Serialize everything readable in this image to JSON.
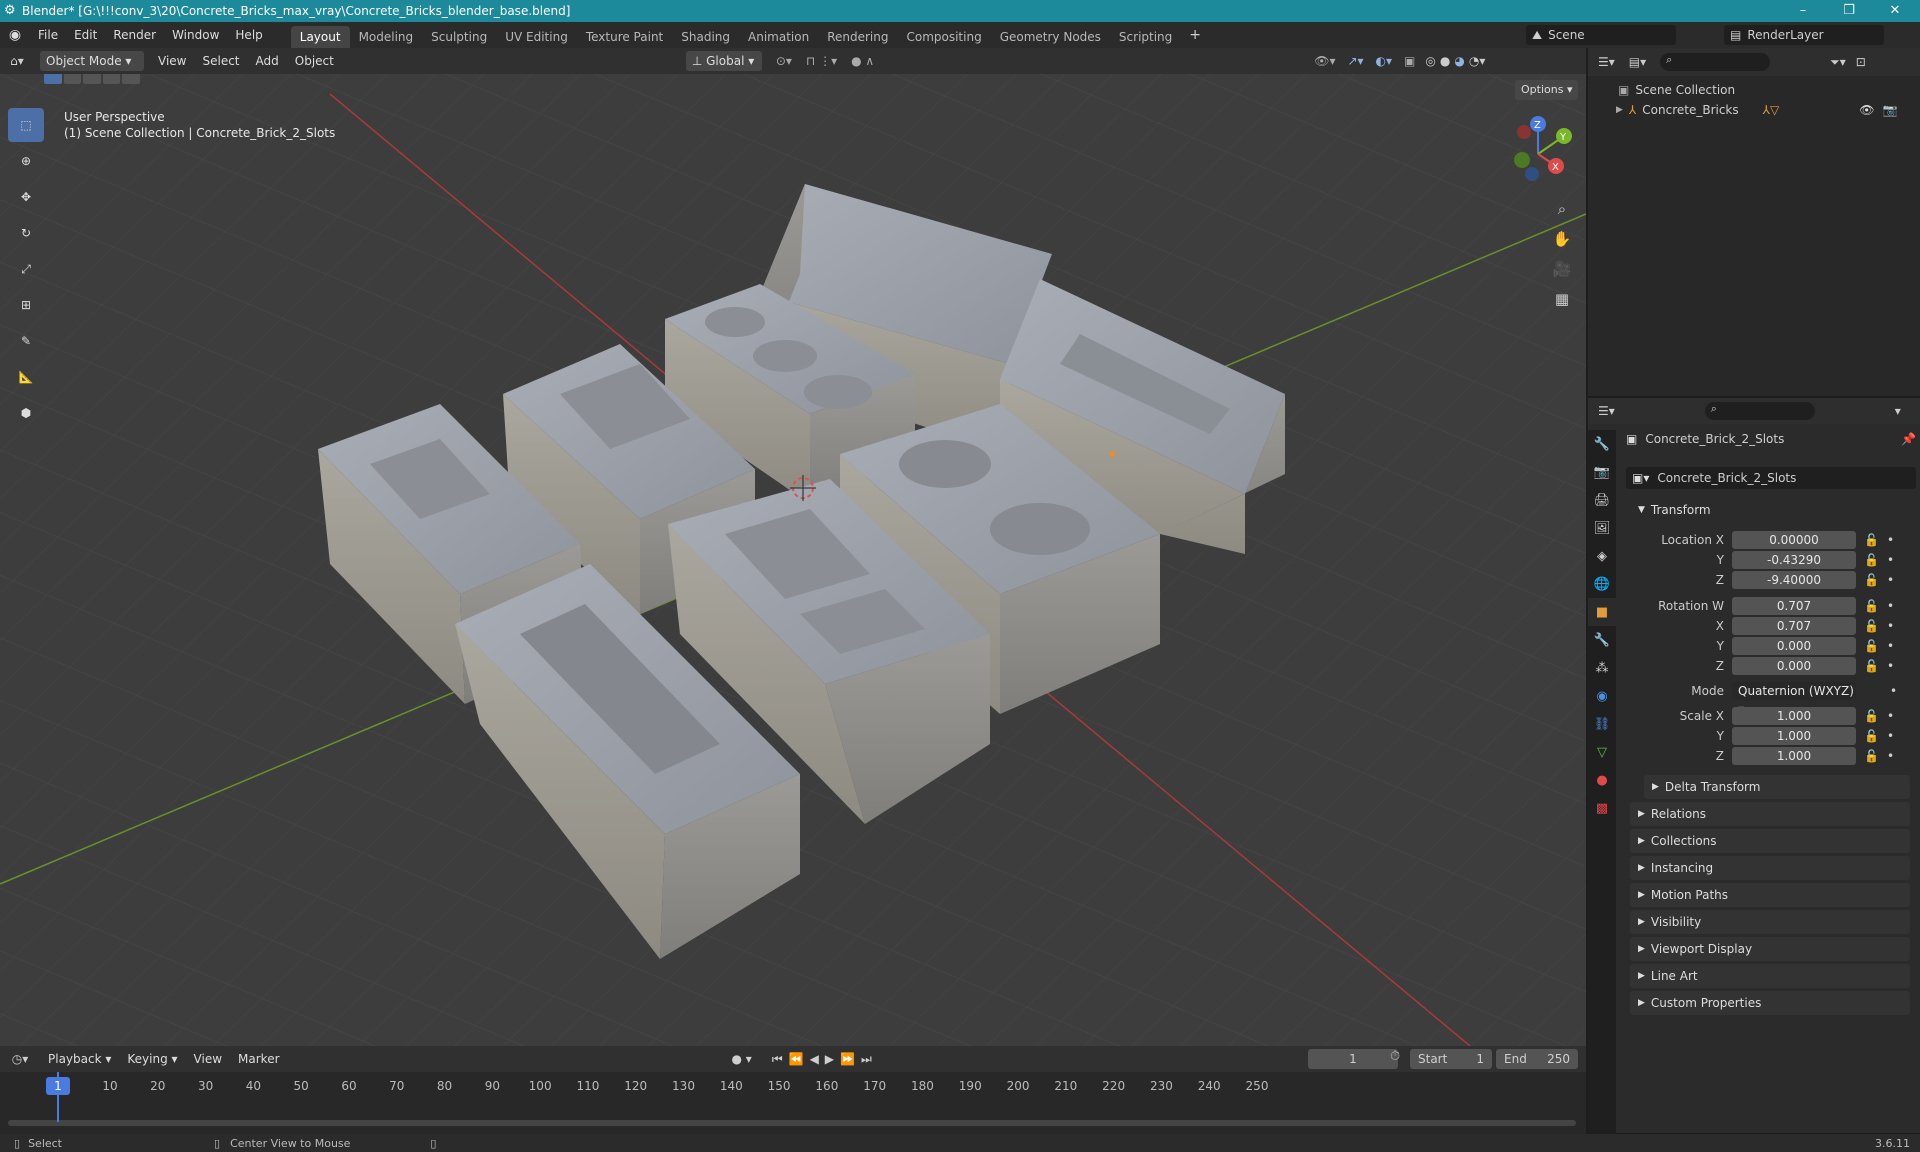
{
  "window": {
    "title": "Blender* [G:\\!!!conv_3\\20\\Concrete_Bricks_max_vray\\Concrete_Bricks_blender_base.blend]"
  },
  "menu": [
    "File",
    "Edit",
    "Render",
    "Window",
    "Help"
  ],
  "workspaces": [
    "Layout",
    "Modeling",
    "Sculpting",
    "UV Editing",
    "Texture Paint",
    "Shading",
    "Animation",
    "Rendering",
    "Compositing",
    "Geometry Nodes",
    "Scripting"
  ],
  "active_workspace": "Layout",
  "scene_name": "Scene",
  "render_layer": "RenderLayer",
  "viewport": {
    "mode": "Object Mode",
    "menus": [
      "View",
      "Select",
      "Add",
      "Object"
    ],
    "orientation": "Global",
    "options_label": "Options",
    "overlay_line1": "User Perspective",
    "overlay_line2": "(1) Scene Collection | Concrete_Brick_2_Slots",
    "gizmo": {
      "x": "X",
      "y": "Y",
      "z": "Z"
    }
  },
  "outliner": {
    "root": "Scene Collection",
    "items": [
      {
        "label": "Concrete_Bricks"
      }
    ]
  },
  "properties": {
    "object_name": "Concrete_Brick_2_Slots",
    "data_name": "Concrete_Brick_2_Slots",
    "transform_title": "Transform",
    "location": {
      "label": "Location X",
      "x": "0.00000",
      "y": "-0.43290",
      "z": "-9.40000"
    },
    "rotation": {
      "label": "Rotation W",
      "w": "0.707",
      "x": "0.707",
      "y": "0.000",
      "z": "0.000"
    },
    "mode": {
      "label": "Mode",
      "value": "Quaternion (WXYZ)"
    },
    "scale": {
      "label": "Scale X",
      "x": "1.000",
      "y": "1.000",
      "z": "1.000"
    },
    "axis_labels": {
      "x": "X",
      "y": "Y",
      "z": "Z"
    },
    "sub_panel": "Delta Transform",
    "panels": [
      "Relations",
      "Collections",
      "Instancing",
      "Motion Paths",
      "Visibility",
      "Viewport Display",
      "Line Art",
      "Custom Properties"
    ]
  },
  "timeline": {
    "menus": [
      "Playback",
      "Keying",
      "View",
      "Marker"
    ],
    "current_frame": "1",
    "start_label": "Start",
    "start": "1",
    "end_label": "End",
    "end": "250",
    "ticks": [
      "1",
      "10",
      "20",
      "30",
      "40",
      "50",
      "60",
      "70",
      "80",
      "90",
      "100",
      "110",
      "120",
      "130",
      "140",
      "150",
      "160",
      "170",
      "180",
      "190",
      "200",
      "210",
      "220",
      "230",
      "240",
      "250"
    ]
  },
  "status": {
    "left": "Select",
    "middle": "Center View to Mouse",
    "version": "3.6.11"
  }
}
